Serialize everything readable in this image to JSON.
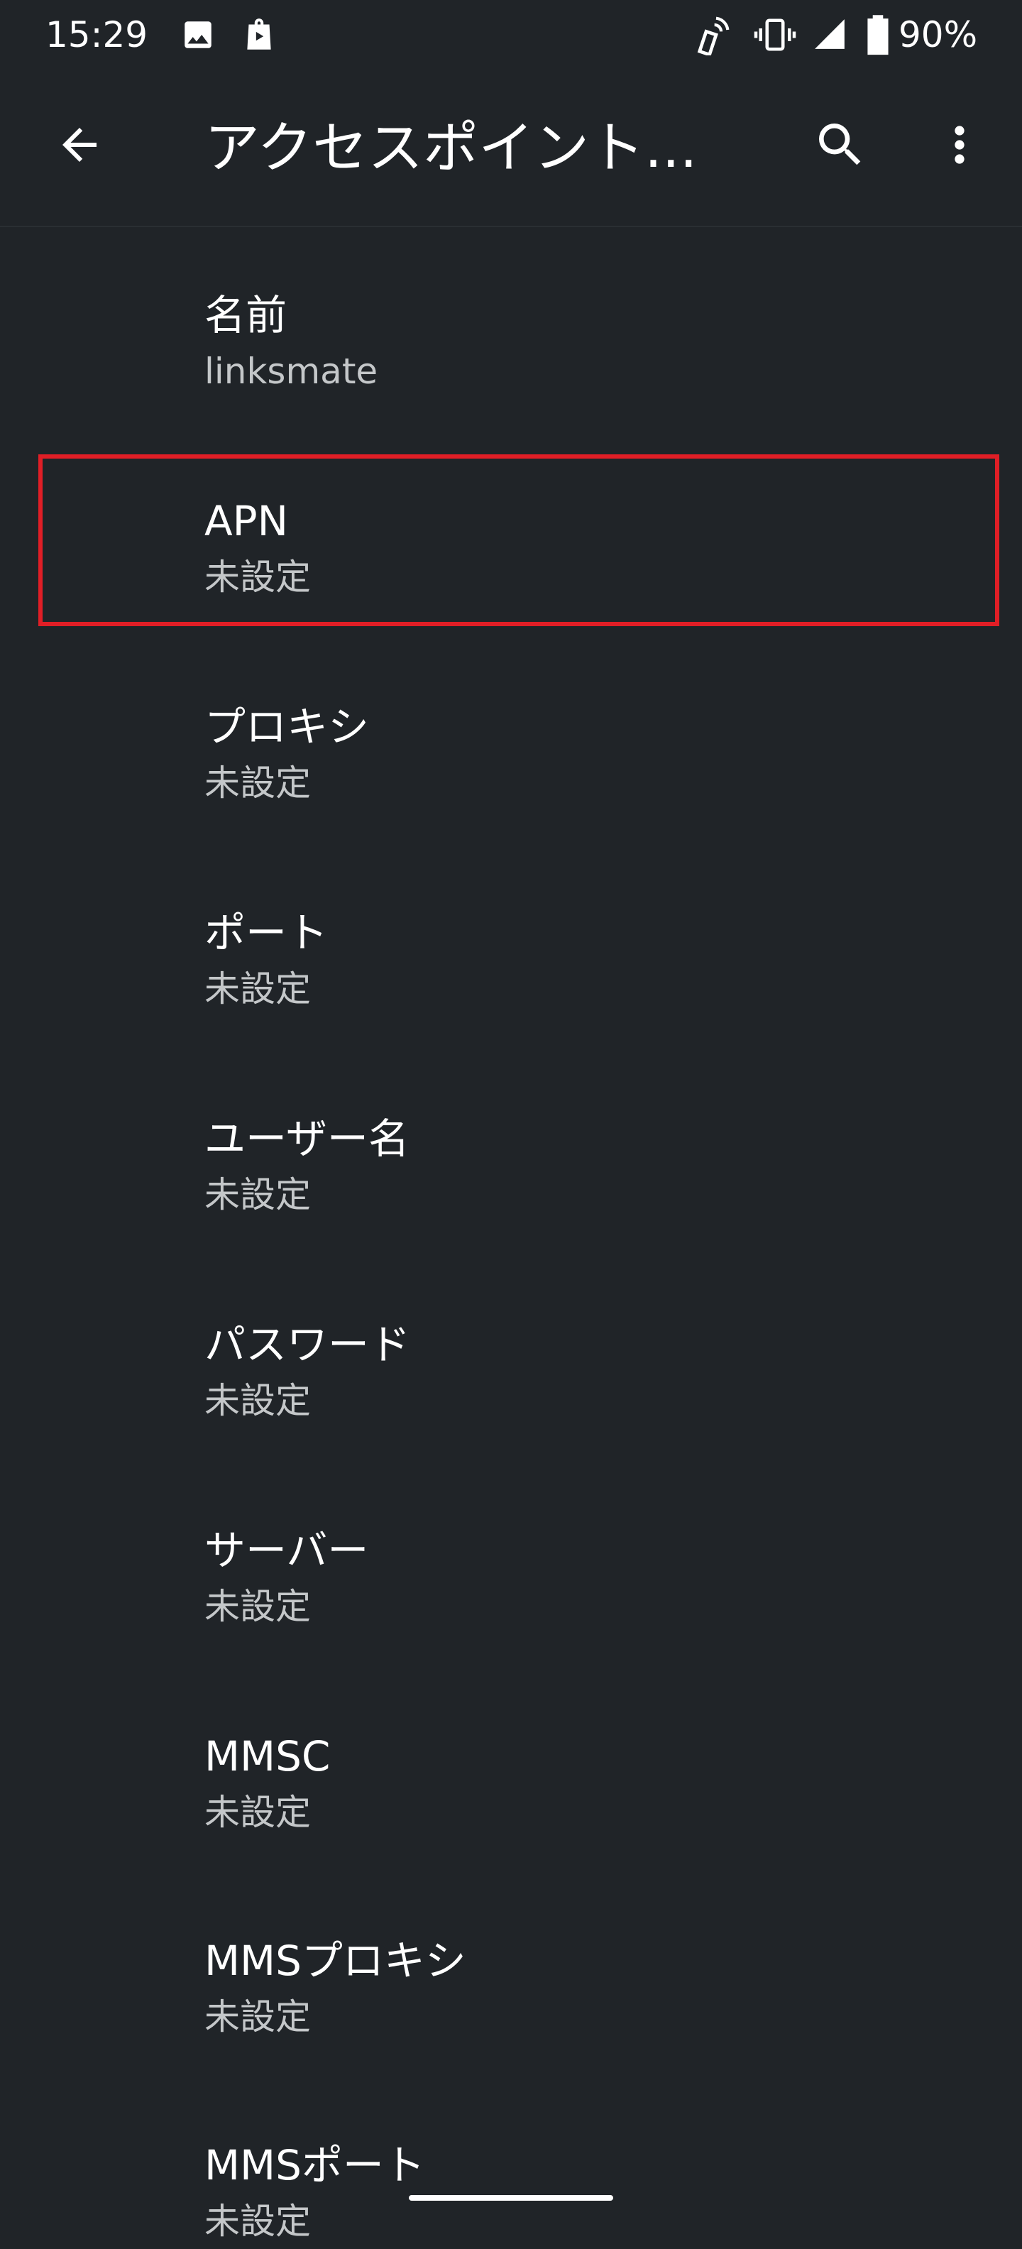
{
  "status_bar": {
    "time": "15:29",
    "battery": "90%",
    "icons": [
      "image-icon",
      "shopping-bag-icon",
      "nfc-icon",
      "vibrate-icon",
      "signal-icon",
      "battery-icon"
    ]
  },
  "app_bar": {
    "title": "アクセスポイント...",
    "icons": [
      "back-arrow-icon",
      "search-icon",
      "more-vert-icon"
    ]
  },
  "prefs": [
    {
      "title": "名前",
      "summary": "linksmate"
    },
    {
      "title": "APN",
      "summary": "未設定"
    },
    {
      "title": "プロキシ",
      "summary": "未設定"
    },
    {
      "title": "ポート",
      "summary": "未設定"
    },
    {
      "title": "ユーザー名",
      "summary": "未設定"
    },
    {
      "title": "パスワード",
      "summary": "未設定"
    },
    {
      "title": "サーバー",
      "summary": "未設定"
    },
    {
      "title": "MMSC",
      "summary": "未設定"
    },
    {
      "title": "MMSプロキシ",
      "summary": "未設定"
    },
    {
      "title": "MMSポート",
      "summary": "未設定"
    }
  ],
  "colors": {
    "background": "#202428",
    "text_primary": "#ffffff",
    "text_secondary": "#c4c7c9",
    "highlight": "#e01e26"
  }
}
